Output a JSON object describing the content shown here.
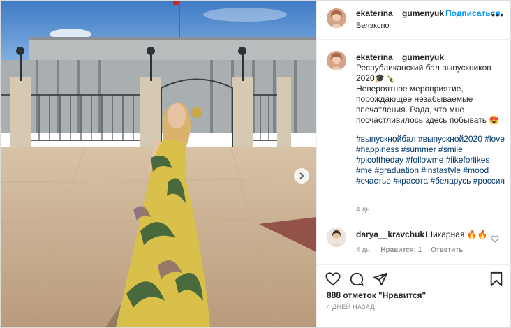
{
  "header": {
    "username": "ekaterina__gumenyuk",
    "separator": "•",
    "follow_label": "Подписаться",
    "location": "Белэкспо",
    "more_label": "•••"
  },
  "caption": {
    "username": "ekaterina__gumenyuk",
    "line1": "Республиканский бал выпускников 2020",
    "emoji1": "🎓🍾",
    "body": "Невероятное мероприятие, порождающее незабываемые впечатления. Рада, что мне посчастливилось здесь побывать",
    "emoji2": "😍",
    "hashtags": "#выпускнойбал #выпускной2020 #love #happiness #summer #smile #picoftheday #followme #likeforlikes #me #graduation #instastyle #mood #счастье #красота #беларусь #россия",
    "time": "4 дн."
  },
  "comment": {
    "username": "darya__kravchuk",
    "text": "Шикарная",
    "emoji": "🔥🔥",
    "time": "4 дн.",
    "likes": "Нравится: 1",
    "reply": "Ответить"
  },
  "footer": {
    "likes_count": "888 отметок \"Нравится\"",
    "posted_ago": "4 ДНЕЙ НАЗАД"
  },
  "icons": [
    "heart-icon",
    "comment-icon",
    "share-icon",
    "bookmark-icon",
    "chevron-right-icon",
    "more-icon"
  ],
  "colors": {
    "follow": "#0095f6",
    "hashtag": "#00376b",
    "muted": "#8e8e8e",
    "text": "#262626"
  }
}
